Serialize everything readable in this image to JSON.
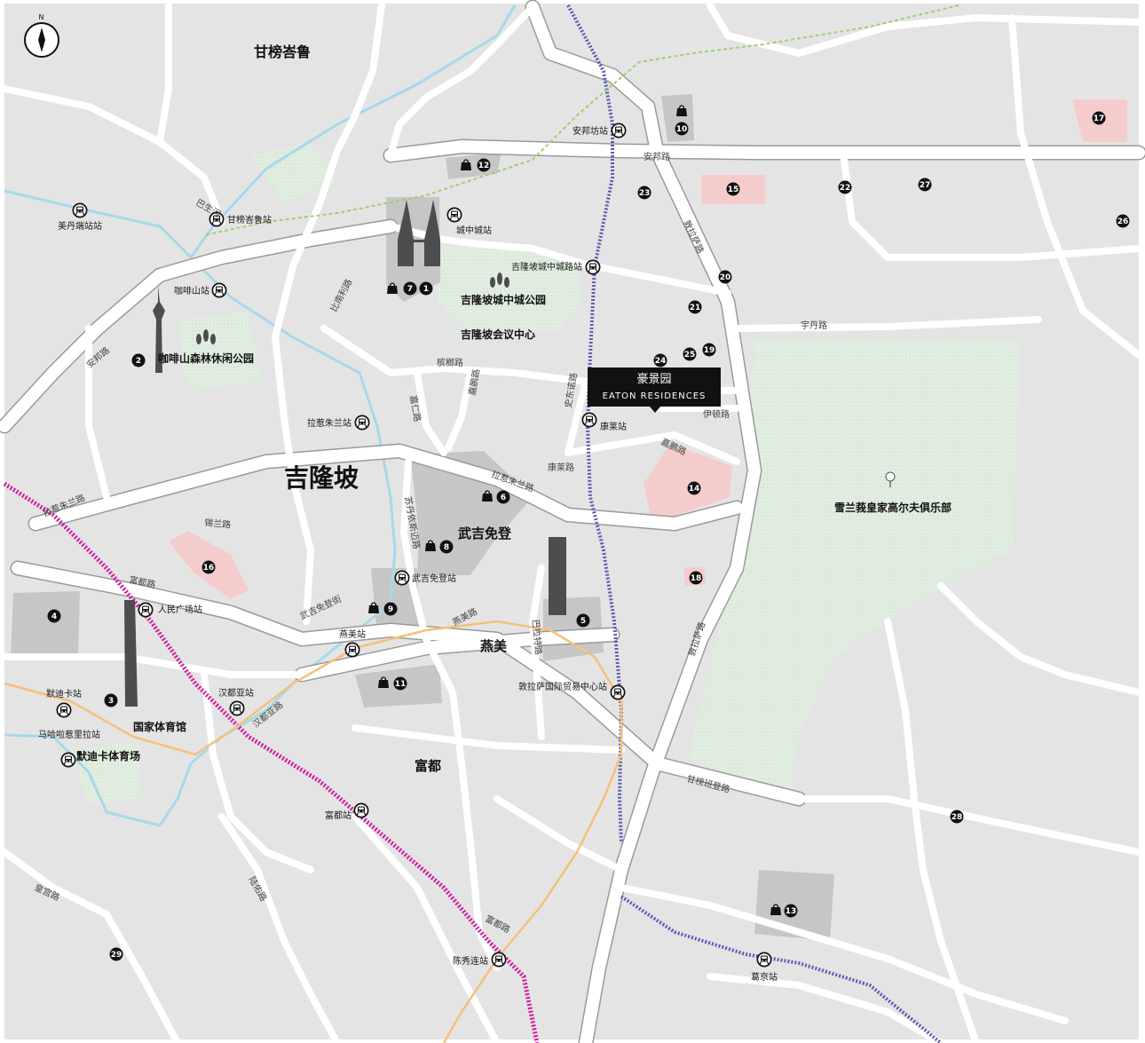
{
  "map": {
    "districts": {
      "kampung_baru": "甘榜峇鲁",
      "kuala_lumpur": "吉隆坡",
      "bukit_bintang": "武吉免登",
      "imbi": "燕美",
      "pudu": "富都"
    },
    "parks": {
      "bukit_nanas": "咖啡山森林休闲公园",
      "klcc_park": "吉隆坡城中城公园",
      "convention": "吉隆坡会议中心",
      "golf": "雪兰莪皇家高尔夫俱乐部"
    },
    "stadiums": {
      "national": "国家体育馆",
      "merdeka": "默迪卡体育场"
    },
    "property": {
      "name_cn": "豪景园",
      "name_en": "EATON RESIDENCES"
    },
    "stations": {
      "medan_tuanku": "美丹端站站",
      "kampung_baru": "甘榜峇鲁站",
      "bukit_nanas": "咖啡山站",
      "klcc": "城中城站",
      "ampang_park": "安邦坊站",
      "klcc_east": "吉隆坡城中城路站",
      "raja_chulan": "拉惹朱兰站",
      "conlay": "康莱站",
      "bukit_bintang": "武吉免登站",
      "pasar_seni": "人民广场站",
      "imbi": "燕美站",
      "hang_tuah": "汉都亚站",
      "merdeka": "默迪卡站",
      "maharajalela": "马哈啦惹里拉站",
      "trx": "敦拉萨国际贸易中心站",
      "pudu": "富都站",
      "chan_sow_lin": "陈秀连站",
      "cochrane": "葛京站"
    },
    "roads": {
      "ampang": "安邦路",
      "ampang2": "安邦路",
      "tun_razak_n": "敦拉萨路",
      "tun_razak_s": "敦拉萨路",
      "yap_kwan": "宇丹路",
      "binjai": "槟榔路",
      "kia_peng": "嘉鹏路",
      "stonor": "史东诺路",
      "eaton": "伊顿路",
      "conlay": "康莱路",
      "raja_chulan": "拉惹朱兰路",
      "raja_chulan_w": "拉惹朱兰路",
      "p_ramlee": "比南利路",
      "sultan_ismail": "苏丹依斯迈路",
      "bukit_bintang": "武吉免登街",
      "imbi": "燕美路",
      "pudu": "富都路",
      "pudu_s": "富都路",
      "hang_tuah": "汉都亚路",
      "barat": "巴拉特路",
      "kampung_pandan": "甘榜班登路",
      "sungai_besi": "陆佑路",
      "istana": "皇宫路",
      "sultan": "锡兰路",
      "kamuning": "嘉仁路",
      "river": "巴生河"
    },
    "markers": [
      "1",
      "2",
      "3",
      "4",
      "5",
      "6",
      "7",
      "8",
      "9",
      "10",
      "11",
      "12",
      "13",
      "14",
      "15",
      "16",
      "17",
      "18",
      "19",
      "20",
      "21",
      "22",
      "23",
      "24",
      "25",
      "26",
      "27",
      "28",
      "29"
    ],
    "colors": {
      "background": "#e4e4e5",
      "road": "#ffffff",
      "road_border": "#9a9a9a",
      "park": "#e1ede0",
      "golf_fill": "#dfeede",
      "shopping": "#c6c6c7",
      "highlight": "#f5cccc",
      "river": "#a6d9ea",
      "rail_purple": "#5b5bb4",
      "rail_magenta": "#d11ba0",
      "rail_green": "#9fd06f",
      "rail_orange": "#f5c07a",
      "label_box": "#111111"
    },
    "icons": [
      "compass-icon",
      "train-station-icon",
      "shopping-bag-icon",
      "golf-icon",
      "tree-icon",
      "tower-icon"
    ]
  }
}
